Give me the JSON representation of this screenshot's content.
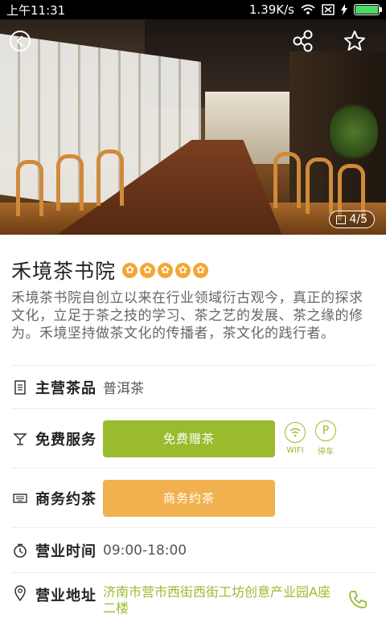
{
  "status_bar": {
    "time": "上午11:31",
    "speed": "1.39K/s",
    "battery_level": 1.0
  },
  "hero": {
    "counter": "4/5"
  },
  "shop": {
    "name": "禾境茶书院",
    "rating": 5,
    "star_glyph": "✿",
    "description": "禾境茶书院自创立以来在行业领域衍古观今，真正的探求文化，立足于茶之技的学习、茶之艺的发展、茶之缘的修为。禾境坚持做茶文化的传播者，茶文化的践行者。"
  },
  "rows": {
    "product": {
      "label": "主营茶品",
      "value": "普洱茶"
    },
    "service": {
      "label": "免费服务",
      "button": "免费赠茶",
      "icons": [
        {
          "name": "wifi-icon",
          "glyph": "≋",
          "label": "WIFI"
        },
        {
          "name": "parking-icon",
          "glyph": "P",
          "label": "停车"
        }
      ]
    },
    "business": {
      "label": "商务约茶",
      "button": "商务约茶"
    },
    "hours": {
      "label": "营业时间",
      "value": "09:00-18:00"
    },
    "address": {
      "label": "营业地址",
      "value": "济南市营市西街西街工坊创意产业园A座二楼"
    }
  },
  "colors": {
    "accent_green": "#9bbb2e",
    "accent_orange": "#f2b14f",
    "star_orange": "#f3a633"
  }
}
